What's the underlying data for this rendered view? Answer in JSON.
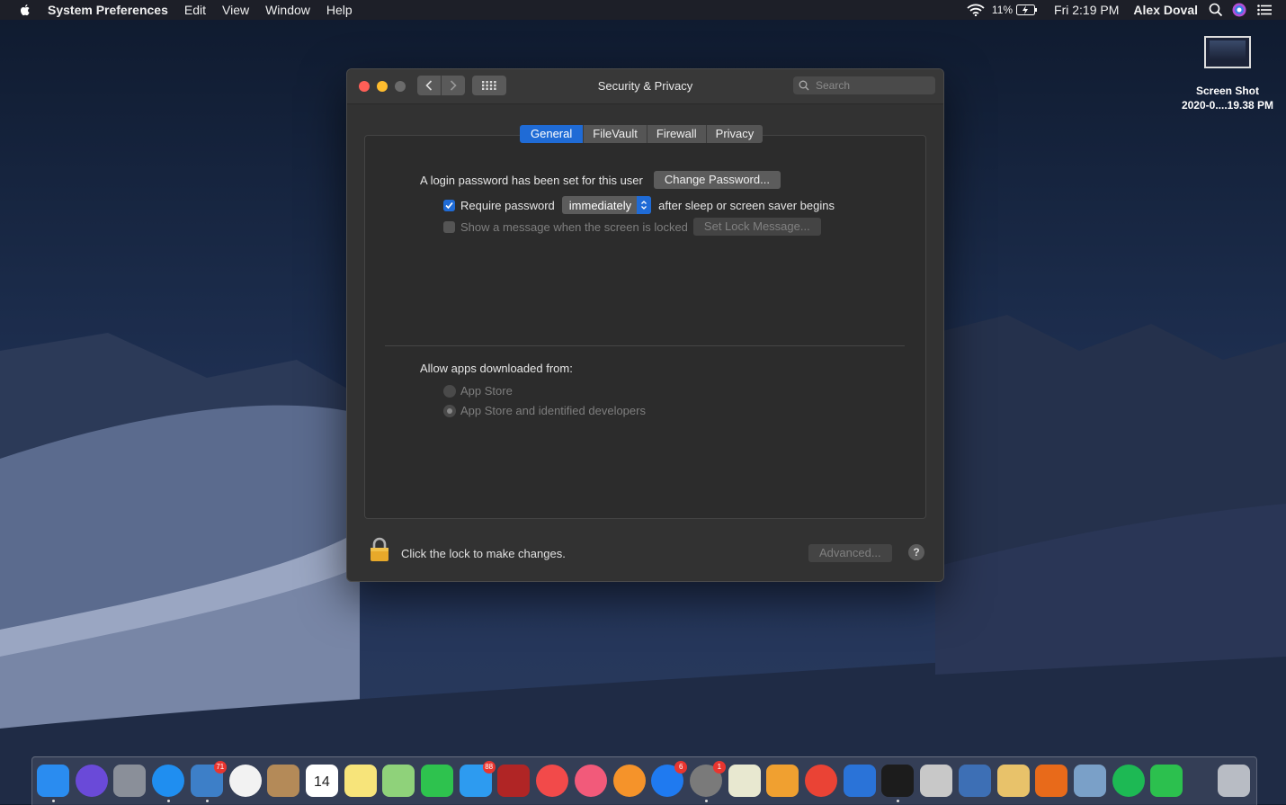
{
  "menubar": {
    "app_name": "System Preferences",
    "menus": [
      "Edit",
      "View",
      "Window",
      "Help"
    ],
    "battery": "11%",
    "datetime": "Fri 2:19 PM",
    "user": "Alex Doval"
  },
  "desktop_file": {
    "name_line1": "Screen Shot",
    "name_line2": "2020-0....19.38 PM"
  },
  "window": {
    "title": "Security & Privacy",
    "search_placeholder": "Search",
    "tabs": [
      "General",
      "FileVault",
      "Firewall",
      "Privacy"
    ],
    "active_tab": "General",
    "login_password_text": "A login password has been set for this user",
    "change_password_label": "Change Password...",
    "require_password_label": "Require password",
    "require_password_checked": true,
    "require_password_value": "immediately",
    "after_sleep_text": "after sleep or screen saver begins",
    "show_message_label": "Show a message when the screen is locked",
    "show_message_checked": false,
    "set_lock_message_label": "Set Lock Message...",
    "allow_apps_label": "Allow apps downloaded from:",
    "radio_options": [
      "App Store",
      "App Store and identified developers"
    ],
    "selected_radio": "App Store and identified developers",
    "lock_text": "Click the lock to make changes.",
    "advanced_label": "Advanced...",
    "help_label": "?"
  },
  "dock": {
    "items": [
      {
        "name": "finder",
        "color": "#2a8cf0"
      },
      {
        "name": "siri",
        "color": "#6a4ad8"
      },
      {
        "name": "launchpad",
        "color": "#8a8f99"
      },
      {
        "name": "safari",
        "color": "#1f8ef0"
      },
      {
        "name": "mail-bird",
        "color": "#3d7fc8",
        "badge": "71"
      },
      {
        "name": "photos",
        "color": "#f2f2f2"
      },
      {
        "name": "contacts",
        "color": "#b48a58"
      },
      {
        "name": "calendar",
        "color": "#ffffff",
        "text": "14"
      },
      {
        "name": "notes",
        "color": "#f7e47a"
      },
      {
        "name": "maps",
        "color": "#8fd27a"
      },
      {
        "name": "facetime",
        "color": "#2ec24e"
      },
      {
        "name": "messages",
        "color": "#2d9bf0",
        "badge": "88"
      },
      {
        "name": "photo-booth",
        "color": "#b02525"
      },
      {
        "name": "news",
        "color": "#f24a4a"
      },
      {
        "name": "music",
        "color": "#f25a7a"
      },
      {
        "name": "books",
        "color": "#f5932a"
      },
      {
        "name": "app-store",
        "color": "#1f7af0",
        "badge": "6"
      },
      {
        "name": "system-preferences",
        "color": "#7a7a7a",
        "badge": "1"
      },
      {
        "name": "python",
        "color": "#e8e8d0"
      },
      {
        "name": "scratch-cat",
        "color": "#f0a030"
      },
      {
        "name": "chrome",
        "color": "#ea4335"
      },
      {
        "name": "bluetooth",
        "color": "#2a73d8"
      },
      {
        "name": "terminal",
        "color": "#1c1c1c"
      },
      {
        "name": "rocket",
        "color": "#c8c8c8"
      },
      {
        "name": "virtualbox",
        "color": "#3d6fb5"
      },
      {
        "name": "textedit",
        "color": "#e8c26a"
      },
      {
        "name": "matlab",
        "color": "#e86a1a"
      },
      {
        "name": "preview",
        "color": "#7aa0c8"
      },
      {
        "name": "spotify",
        "color": "#1db954"
      },
      {
        "name": "numbers",
        "color": "#2cc04e"
      },
      {
        "name": "trash",
        "color": "#b8bcc4"
      }
    ]
  }
}
